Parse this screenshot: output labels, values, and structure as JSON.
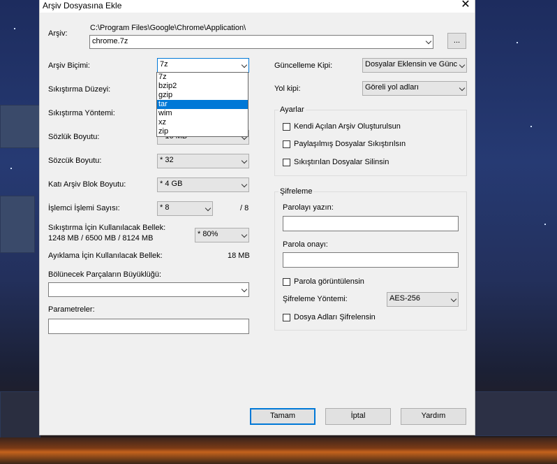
{
  "window": {
    "title": "Arşiv Dosyasına Ekle",
    "close_glyph": "✕"
  },
  "archive": {
    "label": "Arşiv:",
    "path": "C:\\Program Files\\Google\\Chrome\\Application\\",
    "filename": "chrome.7z",
    "browse_label": "..."
  },
  "left": {
    "format_label": "Arşiv Biçimi:",
    "format_value": "7z",
    "format_options": [
      "7z",
      "bzip2",
      "gzip",
      "tar",
      "wim",
      "xz",
      "zip"
    ],
    "format_highlighted": "tar",
    "level_label": "Sıkıştırma Düzeyi:",
    "method_label": "Sıkıştırma Yöntemi:",
    "dict_label": "Sözlük Boyutu:",
    "dict_value": "* 16 MB",
    "word_label": "Sözcük Boyutu:",
    "word_value": "* 32",
    "block_label": "Katı Arşiv Blok Boyutu:",
    "block_value": "* 4 GB",
    "threads_label": "İşlemci İşlemi Sayısı:",
    "threads_value": "* 8",
    "threads_max": "/ 8",
    "mem_comp_label": "Sıkıştırma İçin Kullanılacak Bellek:",
    "mem_comp_value": "1248 MB / 6500 MB / 8124 MB",
    "mem_comp_select": "* 80%",
    "mem_decomp_label": "Ayıklama İçin Kullanılacak Bellek:",
    "mem_decomp_value": "18 MB",
    "split_label": "Bölünecek Parçaların Büyüklüğü:",
    "split_value": "",
    "params_label": "Parametreler:",
    "params_value": ""
  },
  "right": {
    "update_label": "Güncelleme Kipi:",
    "update_value": "Dosyalar Eklensin ve Günc",
    "path_label": "Yol kipi:",
    "path_value": "Göreli yol adları",
    "options_title": "Ayarlar",
    "options": [
      {
        "label": "Kendi Açılan Arşiv Oluşturulsun",
        "checked": false
      },
      {
        "label": "Paylaşılmış Dosyalar Sıkıştırılsın",
        "checked": false
      },
      {
        "label": "Sıkıştırılan Dosyalar Silinsin",
        "checked": false
      }
    ],
    "encryption_title": "Şifreleme",
    "password_label": "Parolayı yazın:",
    "password_value": "",
    "confirm_label": "Parola onayı:",
    "confirm_value": "",
    "show_password_label": "Parola görüntülensin",
    "enc_method_label": "Şifreleme Yöntemi:",
    "enc_method_value": "AES-256",
    "encrypt_names_label": "Dosya Adları Şifrelensin"
  },
  "buttons": {
    "ok": "Tamam",
    "cancel": "İptal",
    "help": "Yardım"
  }
}
